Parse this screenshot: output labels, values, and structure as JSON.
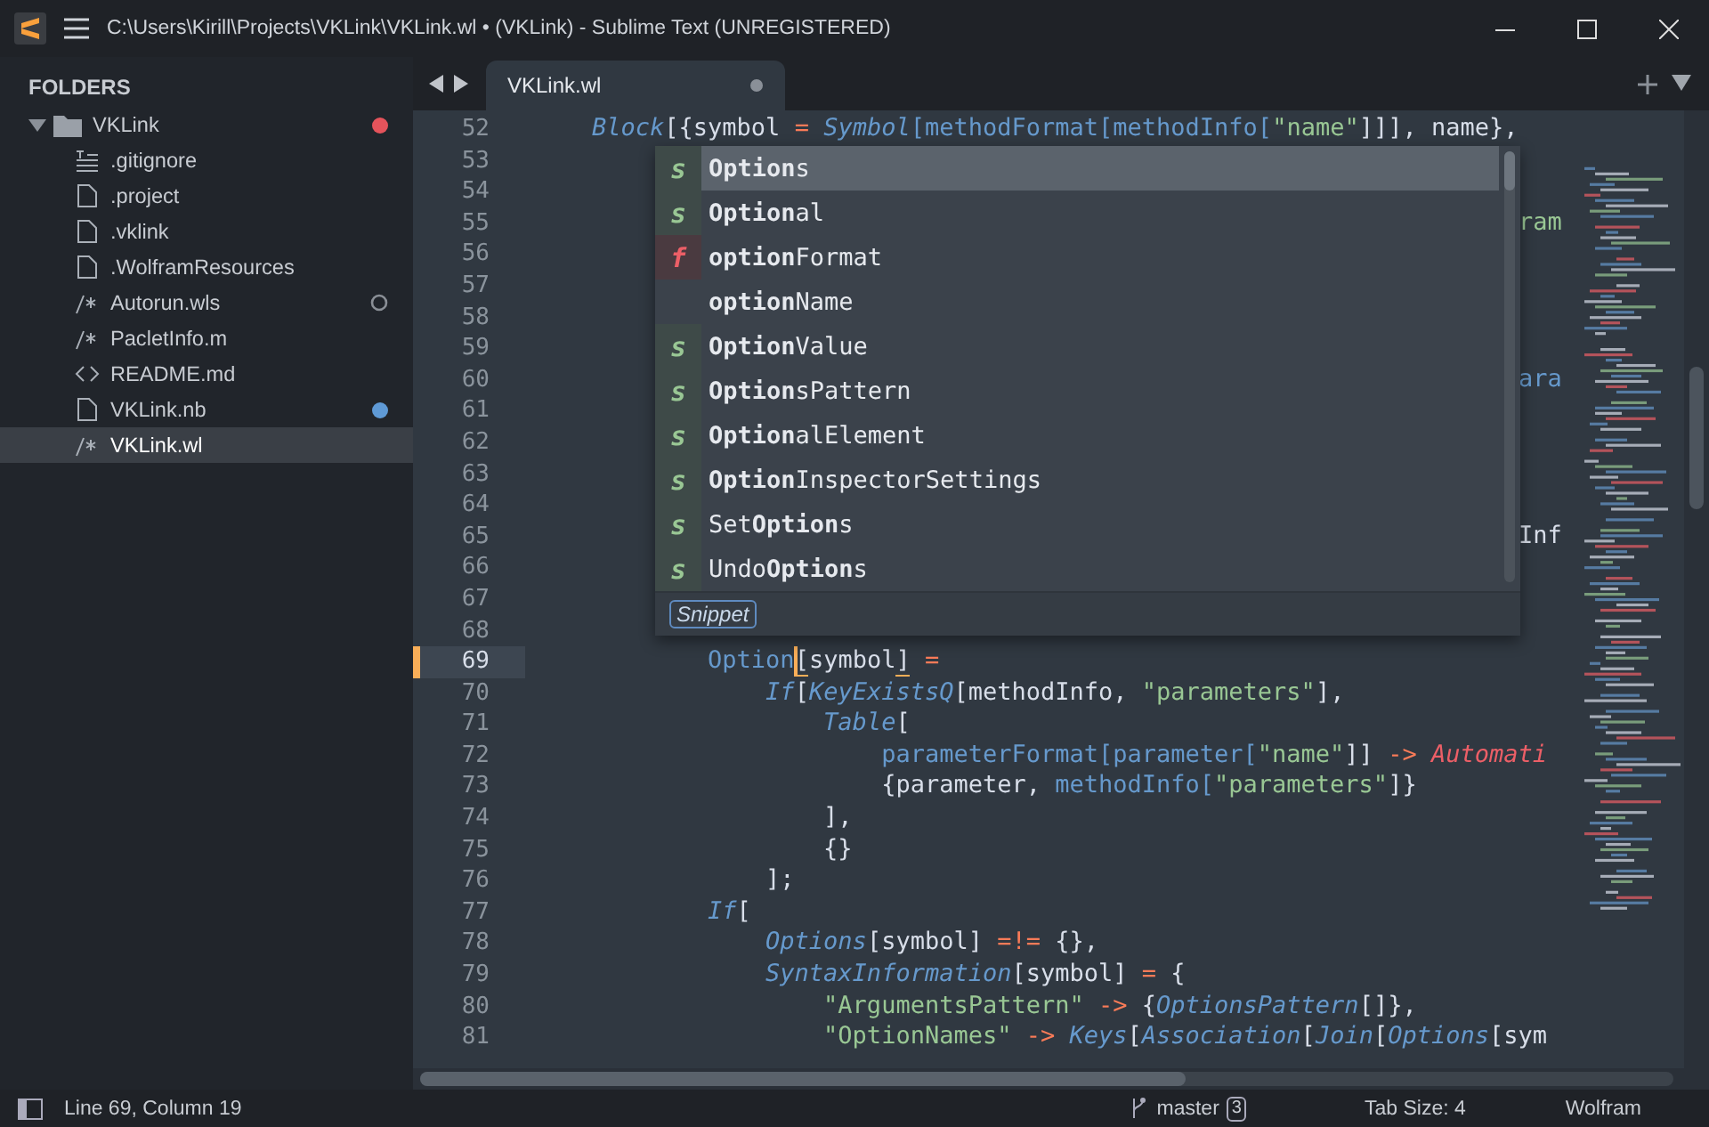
{
  "window": {
    "title": "C:\\Users\\Kirill\\Projects\\VKLink\\VKLink.wl • (VKLink) - Sublime Text (UNREGISTERED)"
  },
  "sidebar": {
    "heading": "FOLDERS",
    "root": {
      "label": "VKLink",
      "expanded": true,
      "marker": {
        "kind": "dot",
        "color": "#e5535b"
      },
      "children": [
        {
          "label": ".gitignore",
          "kind": "lines",
          "selected": false
        },
        {
          "label": ".project",
          "kind": "file",
          "selected": false
        },
        {
          "label": ".vklink",
          "kind": "file",
          "selected": false
        },
        {
          "label": ".WolframResources",
          "kind": "file",
          "selected": false
        },
        {
          "label": "Autorun.wls",
          "kind": "comment",
          "selected": false,
          "marker": {
            "kind": "ring",
            "color": "#8a8f96"
          }
        },
        {
          "label": "PacletInfo.m",
          "kind": "comment",
          "selected": false
        },
        {
          "label": "README.md",
          "kind": "code",
          "selected": false
        },
        {
          "label": "VKLink.nb",
          "kind": "file",
          "selected": false,
          "marker": {
            "kind": "dot",
            "color": "#5f9ad6"
          }
        },
        {
          "label": "VKLink.wl",
          "kind": "comment",
          "selected": true
        }
      ]
    }
  },
  "tabs": [
    {
      "label": "VKLink.wl",
      "selected": true,
      "dirty": true
    }
  ],
  "editor": {
    "lines": [
      {
        "number": "52",
        "current": false,
        "tokens": [
          {
            "t": "    Block",
            "kind": "fn"
          },
          {
            "t": "[{symbol ",
            "kind": "p"
          },
          {
            "t": "=",
            "kind": "op"
          },
          {
            "t": " Symbol",
            "kind": "fn"
          },
          {
            "t": "[methodFormat[methodInfo[",
            "kind": "call"
          },
          {
            "t": "\"name\"",
            "kind": "str"
          },
          {
            "t": "]]], name},",
            "kind": "p"
          }
        ]
      },
      {
        "number": "53",
        "current": false
      },
      {
        "number": "54",
        "current": false
      },
      {
        "number": "55",
        "current": false,
        "peek": [
          {
            "t": "ram",
            "kind": "str"
          }
        ]
      },
      {
        "number": "56",
        "current": false
      },
      {
        "number": "57",
        "current": false
      },
      {
        "number": "58",
        "current": false
      },
      {
        "number": "59",
        "current": false
      },
      {
        "number": "60",
        "current": false,
        "peek": [
          {
            "t": "ara",
            "kind": "call"
          }
        ]
      },
      {
        "number": "61",
        "current": false
      },
      {
        "number": "62",
        "current": false
      },
      {
        "number": "63",
        "current": false
      },
      {
        "number": "64",
        "current": false
      },
      {
        "number": "65",
        "current": false,
        "peek": [
          {
            "t": "Inf",
            "kind": "p"
          }
        ]
      },
      {
        "number": "66",
        "current": false
      },
      {
        "number": "67",
        "current": false
      },
      {
        "number": "68",
        "current": false
      },
      {
        "number": "69",
        "current": true,
        "tokens": [
          {
            "t": "            Option",
            "kind": "call"
          },
          {
            "t": "[",
            "kind": "bracket"
          },
          {
            "t": "symbol",
            "kind": "p"
          },
          {
            "t": "]",
            "kind": "bracket"
          },
          {
            "t": " =",
            "kind": "op"
          }
        ]
      },
      {
        "number": "70",
        "current": false,
        "tokens": [
          {
            "t": "                If",
            "kind": "fn"
          },
          {
            "t": "[",
            "kind": "p"
          },
          {
            "t": "KeyExistsQ",
            "kind": "fn"
          },
          {
            "t": "[methodInfo, ",
            "kind": "p"
          },
          {
            "t": "\"parameters\"",
            "kind": "str"
          },
          {
            "t": "],",
            "kind": "p"
          }
        ]
      },
      {
        "number": "71",
        "current": false,
        "tokens": [
          {
            "t": "                    Table",
            "kind": "fn"
          },
          {
            "t": "[",
            "kind": "p"
          }
        ]
      },
      {
        "number": "72",
        "current": false,
        "tokens": [
          {
            "t": "                        parameterFormat[parameter[",
            "kind": "call"
          },
          {
            "t": "\"name\"",
            "kind": "str"
          },
          {
            "t": "]] ",
            "kind": "p"
          },
          {
            "t": "->",
            "kind": "op"
          },
          {
            "t": " Automati",
            "kind": "const"
          }
        ]
      },
      {
        "number": "73",
        "current": false,
        "tokens": [
          {
            "t": "                        {parameter, ",
            "kind": "p"
          },
          {
            "t": "methodInfo[",
            "kind": "call"
          },
          {
            "t": "\"parameters\"",
            "kind": "str"
          },
          {
            "t": "]}",
            "kind": "p"
          }
        ]
      },
      {
        "number": "74",
        "current": false,
        "tokens": [
          {
            "t": "                    ],",
            "kind": "p"
          }
        ]
      },
      {
        "number": "75",
        "current": false,
        "tokens": [
          {
            "t": "                    {}",
            "kind": "p"
          }
        ]
      },
      {
        "number": "76",
        "current": false,
        "tokens": [
          {
            "t": "                ];",
            "kind": "p"
          }
        ]
      },
      {
        "number": "77",
        "current": false,
        "tokens": [
          {
            "t": "            If",
            "kind": "fn"
          },
          {
            "t": "[",
            "kind": "p"
          }
        ]
      },
      {
        "number": "78",
        "current": false,
        "tokens": [
          {
            "t": "                Options",
            "kind": "fn"
          },
          {
            "t": "[symbol] ",
            "kind": "p"
          },
          {
            "t": "=!=",
            "kind": "op"
          },
          {
            "t": " {},",
            "kind": "p"
          }
        ]
      },
      {
        "number": "79",
        "current": false,
        "tokens": [
          {
            "t": "                SyntaxInformation",
            "kind": "fn"
          },
          {
            "t": "[symbol] ",
            "kind": "p"
          },
          {
            "t": "=",
            "kind": "op"
          },
          {
            "t": " {",
            "kind": "p"
          }
        ]
      },
      {
        "number": "80",
        "current": false,
        "tokens": [
          {
            "t": "                    \"ArgumentsPattern\" ",
            "kind": "str"
          },
          {
            "t": "->",
            "kind": "op"
          },
          {
            "t": " {",
            "kind": "p"
          },
          {
            "t": "OptionsPattern",
            "kind": "fn"
          },
          {
            "t": "[]},",
            "kind": "p"
          }
        ]
      },
      {
        "number": "81",
        "current": false,
        "tokens": [
          {
            "t": "                    \"OptionNames\" ",
            "kind": "str"
          },
          {
            "t": "->",
            "kind": "op"
          },
          {
            "t": " Keys",
            "kind": "fn"
          },
          {
            "t": "[",
            "kind": "p"
          },
          {
            "t": "Association",
            "kind": "fn"
          },
          {
            "t": "[",
            "kind": "p"
          },
          {
            "t": "Join",
            "kind": "fn"
          },
          {
            "t": "[",
            "kind": "p"
          },
          {
            "t": "Options",
            "kind": "fn"
          },
          {
            "t": "[sym",
            "kind": "p"
          }
        ]
      }
    ]
  },
  "completions": {
    "items": [
      {
        "badge": "s",
        "kind": "symbol",
        "label": "**Option**s",
        "selected": true
      },
      {
        "badge": "s",
        "kind": "symbol",
        "label": "**Option**al",
        "selected": false
      },
      {
        "badge": "f",
        "kind": "function",
        "label": "**option**Format",
        "selected": false
      },
      {
        "kind": "none",
        "label": "**option**Name",
        "selected": false
      },
      {
        "badge": "s",
        "kind": "symbol",
        "label": "**Option**Value",
        "selected": false
      },
      {
        "badge": "s",
        "kind": "symbol",
        "label": "**Option**sPattern",
        "selected": false
      },
      {
        "badge": "s",
        "kind": "symbol",
        "label": "**Option**alElement",
        "selected": false
      },
      {
        "badge": "s",
        "kind": "symbol",
        "label": "**Option**InspectorSettings",
        "selected": false
      },
      {
        "badge": "s",
        "kind": "symbol",
        "label": "Set**Option**s",
        "selected": false
      },
      {
        "badge": "s",
        "kind": "symbol",
        "label": "Undo**Option**s",
        "selected": false
      }
    ],
    "detail": "Snippet"
  },
  "status_bar": {
    "position": "Line 69, Column 19",
    "branch": "master",
    "branch_count": "3",
    "tab_size": "Tab Size: 4",
    "syntax": "Wolfram"
  }
}
